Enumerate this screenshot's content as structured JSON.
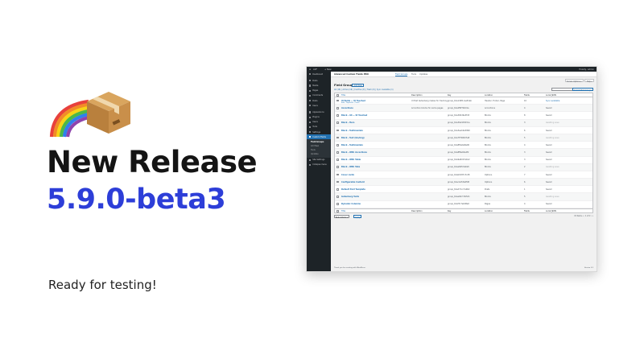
{
  "promo": {
    "title": "New Release",
    "version": "5.9.0-beta3",
    "tagline": "Ready for testing!",
    "icons": [
      "rainbow-icon",
      "package-box-icon"
    ],
    "colors": {
      "title": "#141414",
      "version": "#2d3ed8"
    }
  },
  "screenshot": {
    "adminbar": {
      "site": "ACF",
      "new": "+ New",
      "user": "Howdy, admin"
    },
    "sidebar": {
      "items": [
        {
          "label": "Dashboard"
        },
        {
          "label": "Posts"
        },
        {
          "label": "Media"
        },
        {
          "label": "Pages"
        },
        {
          "label": "Comments"
        },
        {
          "label": "Posts"
        },
        {
          "label": "Users"
        },
        {
          "label": "Appearance"
        },
        {
          "label": "Plugins"
        },
        {
          "label": "Users"
        },
        {
          "label": "Tools"
        },
        {
          "label": "Settings"
        },
        {
          "label": "Custom Fields",
          "active": true
        },
        {
          "label": "Site Settings"
        },
        {
          "label": "Collapse menu"
        }
      ],
      "submenu": [
        "Field Groups",
        "Add New",
        "Tools",
        "Updates"
      ]
    },
    "topbar": {
      "title": "Advanced Custom Fields PRO",
      "tabs": [
        "Field Groups",
        "Tools",
        "Updates"
      ]
    },
    "screen_options": [
      "Screen Options ▾",
      "Help ▾"
    ],
    "page_title": "Field Groups",
    "add_new": "Add New",
    "subsubsub": "All (16) | Active (16) | Inactive (0) | Trash (0) | Sync available (1)",
    "search_button": "Search Field Groups",
    "table": {
      "headers": [
        "Title",
        "Description",
        "Key",
        "Location",
        "Fields",
        "Local JSON"
      ],
      "rows": [
        {
          "title": "UI fields — UI Touched",
          "actions": "Edit | Duplicate | Trash",
          "desc": "UI that Gutenberg makes for tracking",
          "key": "group_61a1d9f1caa52ab",
          "loc": "Header, Footer, Page",
          "fields": "10",
          "sync": "Sync available"
        },
        {
          "title": "Accordions",
          "actions": "",
          "desc": "Accordion blocks for some pages",
          "key": "group_61a2f6f7b0d1a",
          "loc": "Accordions",
          "fields": "4",
          "sync": "Saved"
        },
        {
          "title": "Block - All — UI Touched",
          "actions": "",
          "desc": "",
          "key": "group_61a300d9e3fd3",
          "loc": "Blocks",
          "fields": "8",
          "sync": "Saved"
        },
        {
          "title": "Block - Hero",
          "actions": "",
          "desc": "",
          "key": "group_61a30e3d8d3ce",
          "loc": "Blocks",
          "fields": "3",
          "sync": "Awaiting save"
        },
        {
          "title": "Block - Testimonials",
          "actions": "",
          "desc": "",
          "key": "group_61a3ee16e5999",
          "loc": "Blocks",
          "fields": "6",
          "sync": "Saved"
        },
        {
          "title": "Block - Text (bio/img)",
          "actions": "",
          "desc": "",
          "key": "group_61a7f7996d7a8",
          "loc": "Blocks",
          "fields": "5",
          "sync": "Awaiting save"
        },
        {
          "title": "Block - Testimonials",
          "actions": "",
          "desc": "",
          "key": "group_61a8f0a0a8e90",
          "loc": "Blocks",
          "fields": "4",
          "sync": "Saved"
        },
        {
          "title": "Block - With Accordions",
          "actions": "",
          "desc": "",
          "key": "group_61a8f8e94a4f2",
          "loc": "Blocks",
          "fields": "3",
          "sync": "Saved"
        },
        {
          "title": "Block - With Table",
          "actions": "",
          "desc": "",
          "key": "group_61a9a8c67a1b2",
          "loc": "Blocks",
          "fields": "3",
          "sync": "Saved"
        },
        {
          "title": "Block - With Tabs",
          "actions": "",
          "desc": "",
          "key": "group_61aa0bfc0e6a5",
          "loc": "Blocks",
          "fields": "2",
          "sync": "Awaiting save"
        },
        {
          "title": "Cover cards",
          "actions": "",
          "desc": "",
          "key": "group_61ab0187c3c28",
          "loc": "Options",
          "fields": "7",
          "sync": "Saved"
        },
        {
          "title": "Configurable Content",
          "actions": "",
          "desc": "",
          "key": "group_61ac2e53a6fd8",
          "loc": "Options",
          "fields": "6",
          "sync": "Saved"
        },
        {
          "title": "Default Post Template",
          "actions": "",
          "desc": "",
          "key": "group_61ad71cc7a9b2",
          "loc": "Posts",
          "fields": "1",
          "sync": "Saved"
        },
        {
          "title": "Gutenberg Tests",
          "actions": "",
          "desc": "",
          "key": "group_61ae0b7c3b5d1",
          "loc": "Blocks",
          "fields": "5",
          "sync": "Awaiting save"
        },
        {
          "title": "Dynamic Columns",
          "actions": "",
          "desc": "",
          "key": "group_61af3c7e6d8e0",
          "loc": "Pages",
          "fields": "4",
          "sync": "Saved"
        }
      ]
    },
    "bulk_actions": "Bulk Actions ▾",
    "apply": "Apply",
    "pager": "15 items   «  ‹   1  of 2   ›  »",
    "footer": {
      "left": "Thank you for creating with WordPress.",
      "right": "Version 5.9"
    }
  }
}
